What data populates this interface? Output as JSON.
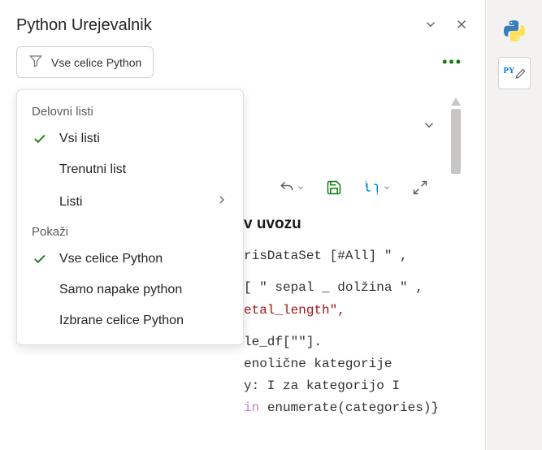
{
  "header": {
    "title": "Python Urejevalnik"
  },
  "filter": {
    "label": "Vse celice Python"
  },
  "dropdown": {
    "section1_label": "Delovni listi",
    "items1": [
      {
        "label": "Vsi listi",
        "checked": true
      },
      {
        "label": "Trenutni list",
        "checked": false
      },
      {
        "label": "Listi",
        "checked": false,
        "submenu": true
      }
    ],
    "section2_label": "Pokaži",
    "items2": [
      {
        "label": "Vse celice Python",
        "checked": true
      },
      {
        "label": "Samo napake python",
        "checked": false
      },
      {
        "label": "Izbrane celice Python",
        "checked": false
      }
    ]
  },
  "code": {
    "heading": "v uvozu",
    "line1": "risDataSet [#All] \" ,",
    "line2a": "[ \" sepal _ dolžina \" ,",
    "line2b": "etal_length\",",
    "line3": "le_df[\"\"].",
    "line4": "enolične kategorije",
    "line5": "y: I za kategorijo I",
    "line6a": "in ",
    "line6b": "enumerate",
    "line6c": "(categories)}"
  }
}
